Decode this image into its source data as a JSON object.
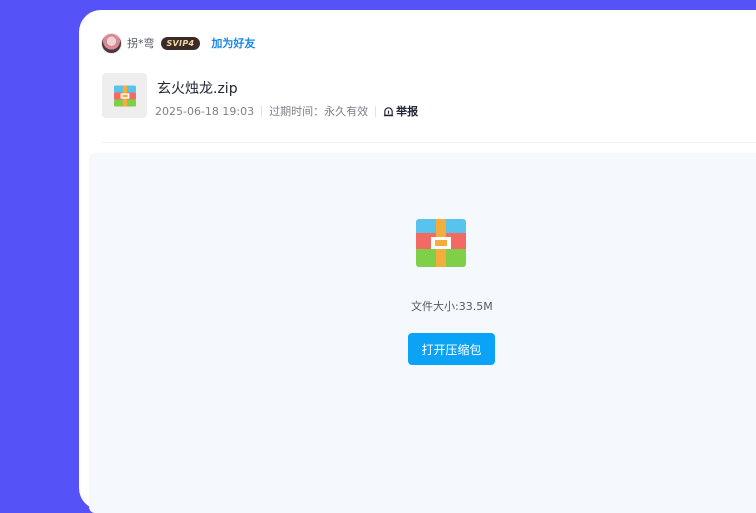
{
  "user": {
    "name": "拐*弯",
    "vip_badge": "SVIP4",
    "add_friend_label": "加为好友"
  },
  "file": {
    "name": "玄火烛龙.zip",
    "upload_time": "2025-06-18 19:03",
    "expiry_label": "过期时间：永久有效",
    "report_label": "举报",
    "icon": "zip-archive-icon",
    "size_label": "文件大小:33.5M",
    "open_button_label": "打开压缩包"
  },
  "colors": {
    "background": "#5552f8",
    "accent": "#0ba3f5",
    "link": "#1a88e8"
  }
}
